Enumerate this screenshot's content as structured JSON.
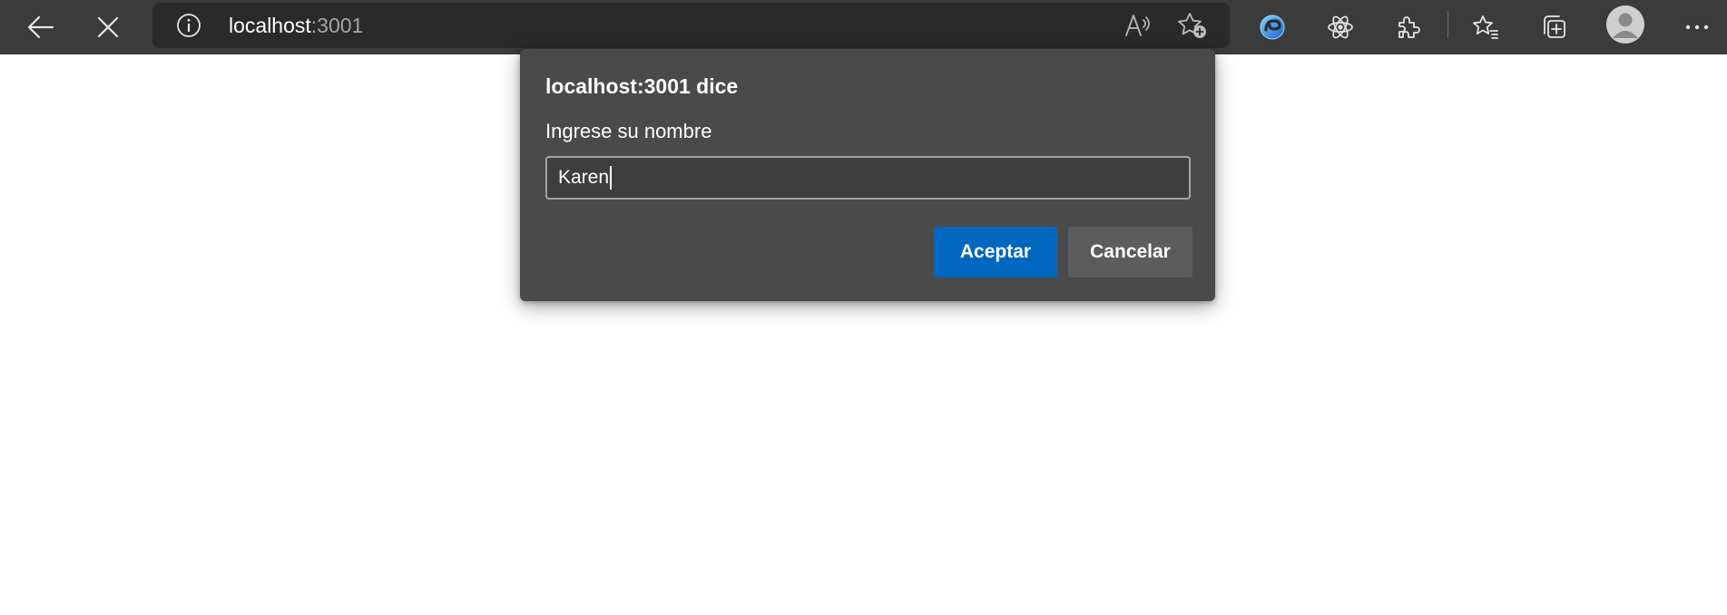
{
  "toolbar": {
    "back_icon": "back-arrow-icon",
    "stop_icon": "close-icon",
    "address": {
      "host": "localhost",
      "port": ":3001",
      "info_icon": "info-icon",
      "read_aloud_icon": "read-aloud-icon",
      "add_favorite_icon": "add-favorite-icon"
    },
    "extensions": [
      "ie-mode-icon",
      "react-devtools-icon",
      "extensions-puzzle-icon"
    ],
    "favorites_icon": "favorites-icon",
    "collections_icon": "collections-icon",
    "profile_icon": "profile-avatar-icon",
    "more_icon": "more-ellipsis-icon"
  },
  "dialog": {
    "title": "localhost:3001 dice",
    "message": "Ingrese su nombre",
    "input_value": "Karen",
    "ok_label": "Aceptar",
    "cancel_label": "Cancelar"
  },
  "colors": {
    "toolbar_bg": "#3b3b3b",
    "address_bg": "#2a2a2a",
    "dialog_bg": "#4a4a4a",
    "accent": "#0067c0",
    "secondary_button": "#5c5c5c"
  }
}
